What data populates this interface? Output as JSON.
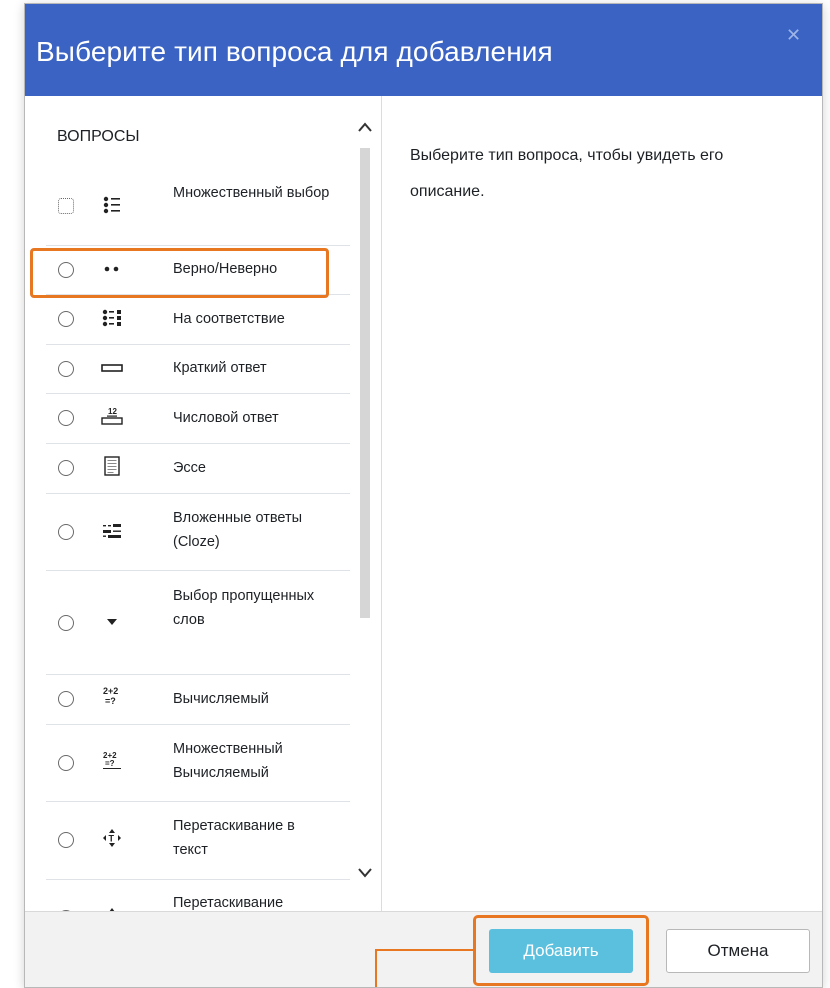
{
  "dialog": {
    "title": "Выберите тип вопроса для добавления",
    "close_icon": "close-icon"
  },
  "left": {
    "section_label": "ВОПРОСЫ",
    "items": [
      {
        "label": "Множественный выбор",
        "icon": "multiple-choice-icon"
      },
      {
        "label": "Верно/Неверно",
        "icon": "true-false-icon"
      },
      {
        "label": "На соответствие",
        "icon": "matching-icon"
      },
      {
        "label": "Краткий ответ",
        "icon": "short-answer-icon"
      },
      {
        "label": "Числовой ответ",
        "icon": "numerical-icon"
      },
      {
        "label": "Эссе",
        "icon": "essay-icon"
      },
      {
        "label": "Вложенные ответы (Cloze)",
        "icon": "cloze-icon"
      },
      {
        "label": "Выбор пропущенных слов",
        "icon": "dropdown-arrow-icon"
      },
      {
        "label": "Вычисляемый",
        "icon": "calculated-icon"
      },
      {
        "label": "Множественный Вычисляемый",
        "icon": "calculated-multi-icon"
      },
      {
        "label": "Перетаскивание в текст",
        "icon": "drag-drop-text-icon"
      },
      {
        "label": "Перетаскивание",
        "icon": "drag-drop-icon"
      }
    ]
  },
  "right": {
    "description": "Выберите тип вопроса, чтобы увидеть его описание."
  },
  "footer": {
    "add_label": "Добавить",
    "cancel_label": "Отмена"
  },
  "colors": {
    "header": "#3a63c3",
    "accent": "#5bc0de",
    "highlight": "#e87722"
  }
}
